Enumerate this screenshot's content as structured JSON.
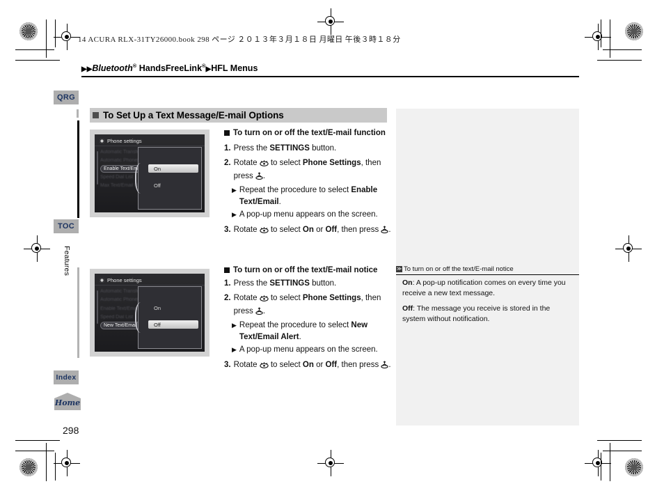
{
  "print_marks": {
    "enabled": true
  },
  "running_head": {
    "book_line": "14 ACURA RLX-31TY26000.book  298 ページ  ２０１３年３月１８日  月曜日  午後３時１８分",
    "breadcrumb_prefix": "▶▶",
    "breadcrumb_italic": "Bluetooth",
    "breadcrumb_sup1": "®",
    "breadcrumb_mid": " HandsFreeLink",
    "breadcrumb_sup2": "®",
    "breadcrumb_arrow": "▶",
    "breadcrumb_tail": "HFL Menus"
  },
  "nav": {
    "qrg": "QRG",
    "toc": "TOC",
    "features": "Features",
    "index": "Index",
    "home": "Home"
  },
  "section": {
    "heading": "To Set Up a Text Message/E-mail Options"
  },
  "screens": [
    {
      "name": "enable-text-email-screen",
      "title": "Phone settings",
      "rows": [
        {
          "label": "Automatic Transfer",
          "state": "blurred"
        },
        {
          "label": "Automatic Phonebook",
          "state": "blurred"
        },
        {
          "label": "Enable Text/Email",
          "state": "selected"
        },
        {
          "label": "Speed Dial List",
          "state": "blurred"
        },
        {
          "label": "Max Text/Email Entries",
          "state": "blurred"
        }
      ],
      "popup": {
        "options": [
          "On",
          "Off"
        ],
        "highlighted": "On"
      }
    },
    {
      "name": "new-text-email-alert-screen",
      "title": "Phone settings",
      "rows": [
        {
          "label": "Automatic Transfer",
          "state": "blurred"
        },
        {
          "label": "Automatic Phonebook",
          "state": "blurred"
        },
        {
          "label": "Enable Text/Email",
          "state": "blurred"
        },
        {
          "label": "Speed Dial List",
          "state": "blurred"
        },
        {
          "label": "New Text/Email Alert",
          "state": "selected"
        }
      ],
      "popup": {
        "options": [
          "On",
          "Off"
        ],
        "highlighted": "Off"
      }
    }
  ],
  "procedures": [
    {
      "heading": "To turn on or off the text/E-mail function",
      "steps": [
        {
          "num": "1.",
          "pre": "Press the ",
          "bold": "SETTINGS",
          "post": " button.",
          "subs": []
        },
        {
          "num": "2.",
          "pre": "Rotate ",
          "knob": "knob-icon",
          "mid": " to select ",
          "bold": "Phone Settings",
          "post": ", then press ",
          "push": "push-icon",
          "tail": ".",
          "subs": [
            {
              "pre": "Repeat the procedure to select ",
              "bold": "Enable Text/Email",
              "post": "."
            },
            {
              "pre": "A pop-up menu appears on the screen.",
              "bold": "",
              "post": ""
            }
          ]
        },
        {
          "num": "3.",
          "pre": "Rotate ",
          "knob": "knob-icon",
          "mid": " to select ",
          "bold": "On",
          "mid2": " or ",
          "bold2": "Off",
          "post": ", then press ",
          "push": "push-icon",
          "tail": ".",
          "subs": []
        }
      ]
    },
    {
      "heading": "To turn on or off the text/E-mail notice",
      "steps": [
        {
          "num": "1.",
          "pre": "Press the ",
          "bold": "SETTINGS",
          "post": " button.",
          "subs": []
        },
        {
          "num": "2.",
          "pre": "Rotate ",
          "knob": "knob-icon",
          "mid": " to select ",
          "bold": "Phone Settings",
          "post": ", then press ",
          "push": "push-icon",
          "tail": ".",
          "subs": [
            {
              "pre": "Repeat the procedure to select ",
              "bold": "New Text/Email Alert",
              "post": "."
            },
            {
              "pre": "A pop-up menu appears on the screen.",
              "bold": "",
              "post": ""
            }
          ]
        },
        {
          "num": "3.",
          "pre": "Rotate ",
          "knob": "knob-icon",
          "mid": " to select ",
          "bold": "On",
          "mid2": " or ",
          "bold2": "Off",
          "post": ", then press ",
          "push": "push-icon",
          "tail": ".",
          "subs": []
        }
      ]
    }
  ],
  "reference": {
    "icon": "≫",
    "heading": "To turn on or off the text/E-mail notice",
    "items": [
      {
        "term": "On",
        "sep": ": ",
        "text": "A pop-up notification comes on every time you receive a new text message."
      },
      {
        "term": "Off",
        "sep": ": ",
        "text": "The message you receive is stored in the system without notification."
      }
    ]
  },
  "footer": {
    "page_number": "298"
  },
  "colors": {
    "tab_gray": "#aeaeae",
    "tab_text_navy": "#1d3461",
    "heading_band": "#c9c9c9",
    "ref_panel": "#f1f1f1",
    "screen_bezel": "#d2d2d2"
  }
}
